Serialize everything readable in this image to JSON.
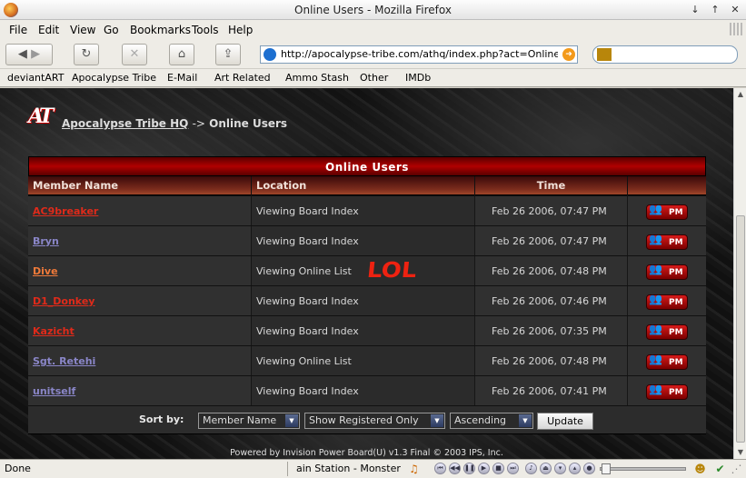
{
  "window": {
    "title": "Online Users - Mozilla Firefox"
  },
  "menu": [
    "File",
    "Edit",
    "View",
    "Go",
    "Bookmarks",
    "Tools",
    "Help"
  ],
  "address": {
    "url": "http://apocalypse-tribe.com/athq/index.php?act=Online&CODE"
  },
  "bookmarks": [
    "deviantART",
    "Apocalypse Tribe",
    "E-Mail",
    "Art Related",
    "Ammo Stash",
    "Other",
    "IMDb"
  ],
  "breadcrumb": {
    "logo": "AT",
    "home": "Apocalypse Tribe HQ",
    "sep": "->",
    "current": "Online Users"
  },
  "table": {
    "title": "Online Users",
    "headers": {
      "member": "Member Name",
      "location": "Location",
      "time": "Time"
    },
    "rows": [
      {
        "name": "AC9breaker",
        "location": "Viewing Board Index",
        "time": "Feb 26 2006, 07:47 PM",
        "pm": "PM",
        "color": "#e02a1a"
      },
      {
        "name": "Bryn",
        "location": "Viewing Board Index",
        "time": "Feb 26 2006, 07:47 PM",
        "pm": "PM",
        "color": "#8a86c8"
      },
      {
        "name": "Dive",
        "location": "Viewing Online List",
        "time": "Feb 26 2006, 07:48 PM",
        "pm": "PM",
        "color": "#f07a3a"
      },
      {
        "name": "D1_Donkey",
        "location": "Viewing Board Index",
        "time": "Feb 26 2006, 07:46 PM",
        "pm": "PM",
        "color": "#e02a1a"
      },
      {
        "name": "Kazicht",
        "location": "Viewing Board Index",
        "time": "Feb 26 2006, 07:35 PM",
        "pm": "PM",
        "color": "#e02a1a"
      },
      {
        "name": "Sgt. Retehi",
        "location": "Viewing Online List",
        "time": "Feb 26 2006, 07:48 PM",
        "pm": "PM",
        "color": "#8a86c8"
      },
      {
        "name": "unitself",
        "location": "Viewing Board Index",
        "time": "Feb 26 2006, 07:41 PM",
        "pm": "PM",
        "color": "#8a86c8"
      }
    ],
    "annotation": "LOL"
  },
  "sort": {
    "label": "Sort by:",
    "field": "Member Name",
    "filter": "Show Registered Only",
    "order": "Ascending",
    "button": "Update"
  },
  "footer": "Powered by Invision Power Board(U) v1.3 Final © 2003  IPS, Inc.",
  "status": {
    "text": "Done",
    "now_playing": "ain Station - Monster"
  }
}
